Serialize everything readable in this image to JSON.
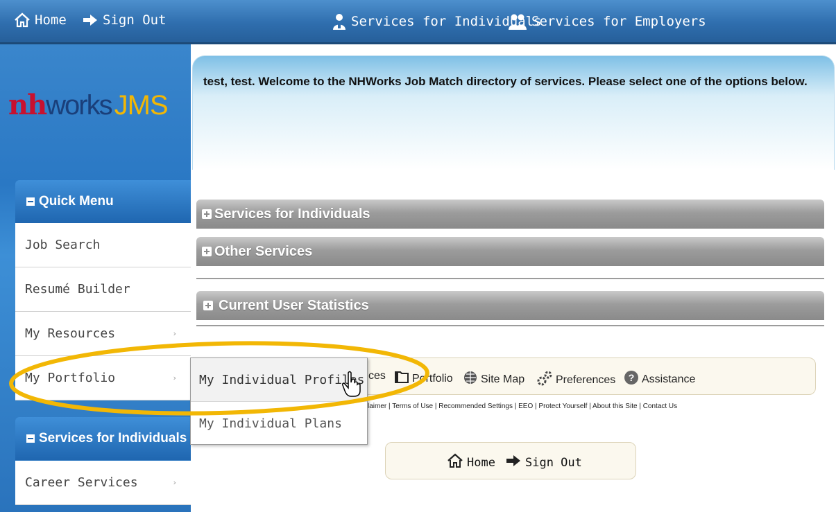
{
  "topbar": {
    "home_label": "Home",
    "signout_label": "Sign Out",
    "individuals_label": "Services for Individuals",
    "employers_label": "Services for Employers"
  },
  "logo": {
    "nh": "nh",
    "works": "works",
    "jms": "JMS"
  },
  "welcome_text": "test, test. Welcome to the NHWorks Job Match directory of services. Please select one of the options below.",
  "quick_menu": {
    "title": "Quick Menu",
    "items": [
      {
        "label": "Job Search"
      },
      {
        "label": "Resumé Builder"
      },
      {
        "label": "My Resources",
        "arrow": "›"
      },
      {
        "label": "My Portfolio",
        "arrow": "›"
      }
    ]
  },
  "portfolio_flyout": {
    "items": [
      {
        "label": "My Individual Profiles"
      },
      {
        "label": "My Individual Plans"
      }
    ]
  },
  "services_menu": {
    "title": "Services for Individuals",
    "items": [
      {
        "label": "Career Services",
        "arrow": "›"
      }
    ]
  },
  "sections": {
    "individuals": "Services for Individuals",
    "other": "Other Services",
    "stats": "Current User Statistics"
  },
  "toolbar": {
    "resources_partial": "ces",
    "portfolio": "Portfolio",
    "sitemap": "Site Map",
    "preferences": "Preferences",
    "assistance": "Assistance"
  },
  "footer_links": "claimer | Terms of Use | Recommended Settings | EEO | Protect Yourself | About this Site | Contact Us",
  "bottom_nav": {
    "home": "Home",
    "signout": "Sign Out"
  },
  "colors": {
    "topbar_blue": "#2f6eae",
    "menu_blue": "#1f66b0",
    "section_gray": "#9c9c9c",
    "highlight_yellow": "#f2b705",
    "logo_red": "#c8102e",
    "logo_navy": "#1a3f7a"
  }
}
